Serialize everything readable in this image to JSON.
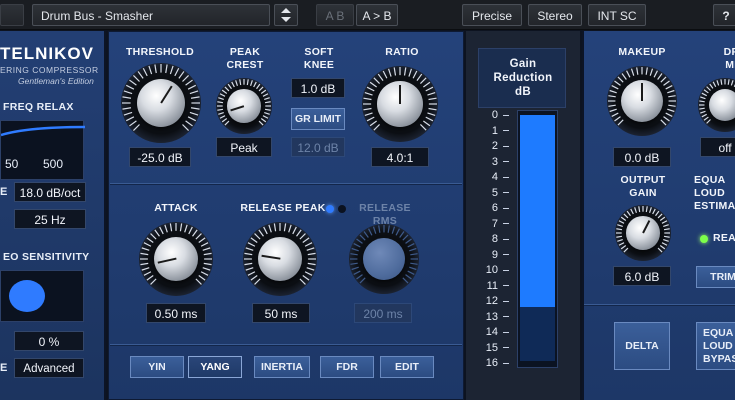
{
  "topbar": {
    "preset": "Drum Bus - Smasher",
    "ab": "A B",
    "a_to_b": "A > B",
    "precise": "Precise",
    "stereo": "Stereo",
    "int_sc": "INT SC",
    "prev_next_icon": "up-down-arrows-icon"
  },
  "left": {
    "brand": "TELNIKOV",
    "subtitle": "ERING COMPRESSOR",
    "edition": "Gentleman's Edition",
    "freq_relax": "FREQ RELAX",
    "freq_low": "50",
    "freq_high": "500",
    "slope_label": "E",
    "slope_value": "18.0 dB/oct",
    "hz_value": "25 Hz",
    "stereo_sensitivity": "EO SENSITIVITY",
    "percent": "0 %",
    "mode_label": "E",
    "mode_value": "Advanced",
    "accent": "#2f7bff"
  },
  "middle": {
    "threshold_label": "THRESHOLD",
    "threshold_value": "-25.0 dB",
    "threshold_level": 0.62,
    "peak_crest_label": "PEAK\nCREST",
    "peak_crest_value": "Peak",
    "peak_crest_level": 0.1,
    "soft_knee_label": "SOFT\nKNEE",
    "soft_knee_value": "1.0 dB",
    "gr_limit": "GR LIMIT",
    "gr_limit_value": "12.0 dB",
    "ratio_label": "RATIO",
    "ratio_value": "4.0:1",
    "ratio_level": 0.5,
    "attack_label": "ATTACK",
    "attack_value": "0.50 ms",
    "attack_level": 0.12,
    "release_peak_label": "RELEASE PEAK",
    "release_peak_value": "50 ms",
    "release_peak_level": 0.2,
    "release_rms_label": "RELEASE RMS",
    "release_rms_value": "200 ms",
    "buttons": [
      "YIN",
      "YANG",
      "INERTIA",
      "FDR",
      "EDIT"
    ]
  },
  "meter": {
    "title": "Gain\nReduction\ndB",
    "ticks": [
      "0",
      "1",
      "2",
      "3",
      "4",
      "5",
      "6",
      "7",
      "8",
      "9",
      "10",
      "11",
      "12",
      "13",
      "14",
      "15",
      "16"
    ],
    "reduction_db": 12.5,
    "hold_db": 16,
    "bar_color": "#1e7bff"
  },
  "right": {
    "makeup_label": "MAKEUP",
    "makeup_value": "0.0 dB",
    "makeup_level": 0.5,
    "dry_mix_label": "DRY\nMIX",
    "dry_mix_value": "off",
    "output_gain_label": "OUTPUT\nGAIN",
    "output_gain_value": "6.0 dB",
    "output_gain_level": 0.6,
    "equal_loud_label": "EQUA\nLOUD\nESTIMA",
    "rea_label": "REA",
    "trim_label": "TRIM",
    "delta_label": "DELTA",
    "bypass_label": "EQUA\nLOUD\nBYPAS"
  }
}
